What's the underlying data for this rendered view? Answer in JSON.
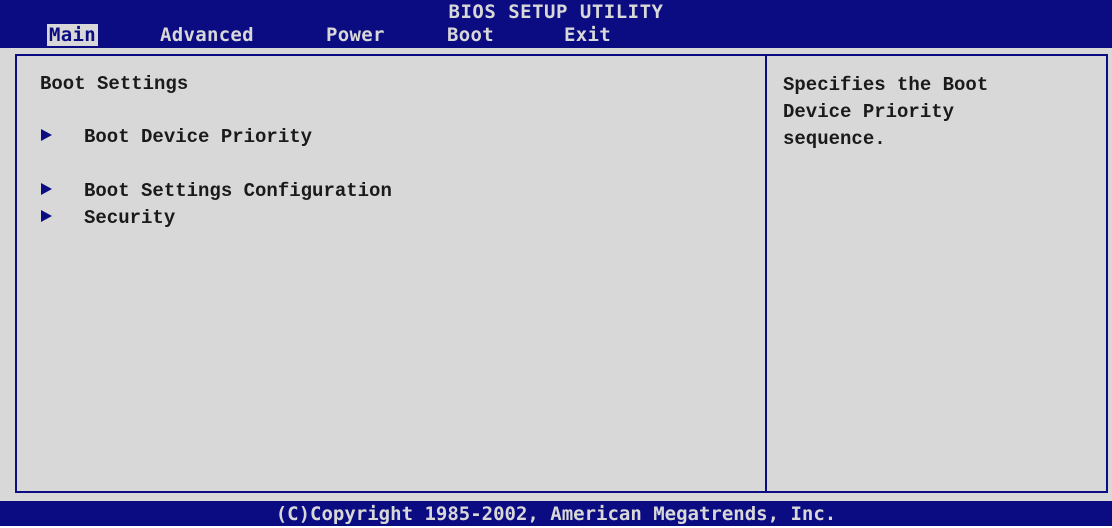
{
  "header": {
    "title": "BIOS SETUP UTILITY"
  },
  "menu": {
    "items": [
      {
        "label": "Main",
        "active": true
      },
      {
        "label": "Advanced",
        "active": false
      },
      {
        "label": "Power",
        "active": false
      },
      {
        "label": "Boot",
        "active": false
      },
      {
        "label": "Exit",
        "active": false
      }
    ]
  },
  "main": {
    "section_title": "Boot Settings",
    "submenus": [
      {
        "label": "Boot Device Priority",
        "icon": "triangle-right-icon"
      },
      {
        "label": "Boot Settings Configuration",
        "icon": "triangle-right-icon"
      },
      {
        "label": "Security",
        "icon": "triangle-right-icon"
      }
    ]
  },
  "help": {
    "line1": "Specifies the Boot",
    "line2": "Device Priority",
    "line3": "sequence."
  },
  "footer": {
    "copyright": "(C)Copyright 1985-2002, American Megatrends, Inc."
  },
  "colors": {
    "bar_background": "#0c0c82",
    "body_background": "#d8d8d8",
    "text": "#1a1a1a",
    "bar_text": "#d8d8d8"
  }
}
